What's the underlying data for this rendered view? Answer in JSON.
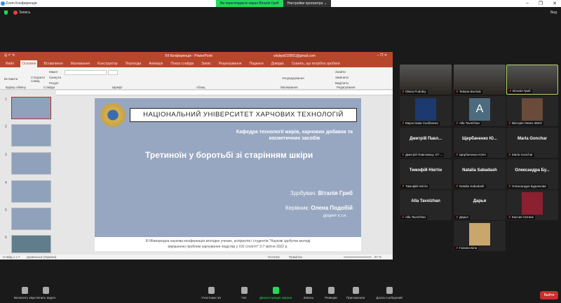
{
  "window": {
    "title": "Zoom Конференція",
    "controls": [
      "–",
      "❐",
      "✕"
    ]
  },
  "share_banner": {
    "text": "Ви переглядаєте екран Віталія Гриб",
    "options": "Настройки просмотра",
    "chevron": "⌄"
  },
  "meeting_bar": {
    "record": "Запись",
    "view": "Вид"
  },
  "powerpoint": {
    "title": "XII Конференція - PowerPoint",
    "account": "vitaliya010001@gmail.com",
    "tabs": [
      "Файл",
      "Основне",
      "Вставлення",
      "Малювання",
      "Конструктор",
      "Переходи",
      "Анімація",
      "Показ слайдів",
      "Запис",
      "Рецензування",
      "Подання",
      "Довідка",
      "Скажіть, що потрібно зробити"
    ],
    "active_tab": "Основне",
    "groups": [
      "Буфер обміну",
      "Слайди",
      "Шрифт",
      "Абзац",
      "Малювання",
      "Редагування"
    ],
    "ribbon_buttons": {
      "paste": "Вставити",
      "new_slide": "Створити слайд",
      "layout": "Макет",
      "reset": "Скинути",
      "section": "Розділ",
      "arrange": "Упорядкування",
      "find": "Знайти",
      "replace": "Замінити",
      "select": "Виділити"
    },
    "slide_numbers": [
      "1",
      "2",
      "3",
      "4",
      "5",
      "6"
    ],
    "status": {
      "slide": "Слайд 1 з 7",
      "lang": "українська (Україна)",
      "notes": "Нотатки",
      "comments": "Примітки",
      "zoom": "57 %"
    },
    "slide": {
      "university": "НАЦІОНАЛЬНИЙ УНІВЕРСИТЕТ ХАРЧОВИХ ТЕХНОЛОГІЙ",
      "department": "Кафедра технології жирів, харчових добавок та косметичних засобів",
      "title": "Третиноїн у боротьбі зі старінням шкіри",
      "student_label": "Здобувач: ",
      "student": "Віталія Гриб",
      "supervisor_label": "Керівник: ",
      "supervisor": "Олена Подобій",
      "degree": "доцент к.т.н.",
      "footer1": "ІІІ Міжнародна наукова конференція молодих учених, аспірантів і студентів \"Наукові здобутки молоді",
      "footer2": "вирішенню проблем харчування людства у ХХІ столітті\" 3-7 квітня 2022 р."
    }
  },
  "participants": [
    {
      "name": "Olena Podobiy",
      "kind": "video"
    },
    {
      "name": "Tetiana Bochuk",
      "kind": "video"
    },
    {
      "name": "Віталія Гриб",
      "kind": "video",
      "active": true
    },
    {
      "name": "Мирослава Скобленко",
      "kind": "pic"
    },
    {
      "name": "Alla Tavolzhan",
      "kind": "letter",
      "letter": "A"
    },
    {
      "name": "Вікторія Левко-4БЕЗ",
      "kind": "pic"
    },
    {
      "name": "Дмитрій Павловець ХТ-...",
      "display": "Дмитрій Павл...",
      "kind": "text"
    },
    {
      "name": "Щербаченко Юлія",
      "display": "Щербаченко Ю...",
      "kind": "text"
    },
    {
      "name": "Marla Gonchar",
      "display": "Marla Gonchar",
      "kind": "text"
    },
    {
      "name": "Тимофій Нікітін",
      "display": "Тимофій Нікітін",
      "kind": "text"
    },
    {
      "name": "Natalia Sabadash",
      "display": "Natalia Sabadash",
      "kind": "text"
    },
    {
      "name": "Олександра Буденкова",
      "display": "Олександра Бу...",
      "kind": "text"
    },
    {
      "name": "Alla Tavolzhan",
      "display": "Alla Tavolzhan",
      "kind": "text"
    },
    {
      "name": "Дарья",
      "display": "Дарья",
      "kind": "text"
    },
    {
      "name": "Кассия Ситник",
      "kind": "pic"
    },
    {
      "name": "Галина Біла",
      "kind": "pic"
    }
  ],
  "toolbar": {
    "audio": "Включить звук",
    "video": "Начать видео",
    "participants": "Участники",
    "participants_count": "16",
    "chat": "Чат",
    "share": "Демонстрация экрана",
    "record": "Запись",
    "reactions": "Реакции",
    "apps": "Приложения",
    "whiteboard": "Доска сообщений",
    "leave": "Выйти"
  }
}
